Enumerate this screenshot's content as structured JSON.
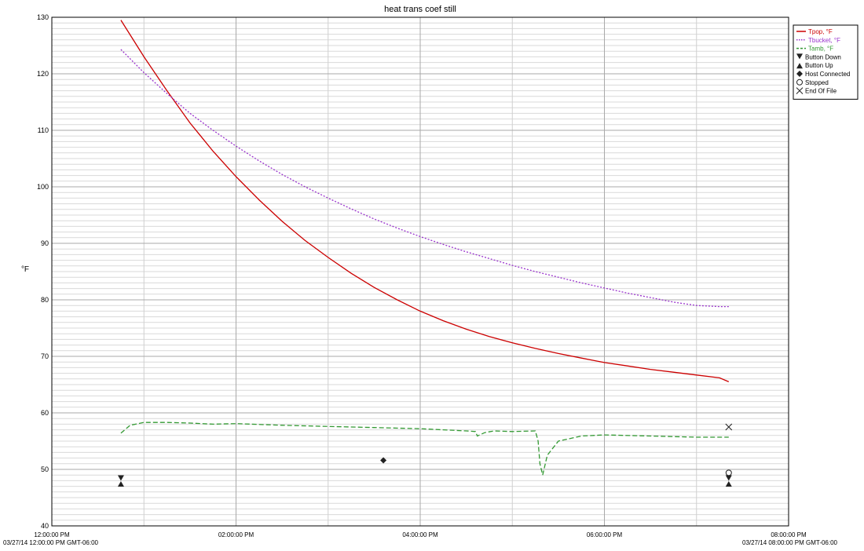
{
  "chart_data": {
    "type": "line",
    "title": "heat trans coef still",
    "ylabel": "°F",
    "ylim": [
      40,
      130
    ],
    "yticks": [
      40,
      50,
      60,
      70,
      80,
      90,
      100,
      110,
      120,
      130
    ],
    "xlim_hours": [
      0,
      8
    ],
    "xticks": [
      {
        "hour": 0,
        "label": "12:00:00 PM",
        "sublabel": "03/27/14 12:00:00 PM GMT-06:00"
      },
      {
        "hour": 2,
        "label": "02:00:00 PM",
        "sublabel": ""
      },
      {
        "hour": 4,
        "label": "04:00:00 PM",
        "sublabel": ""
      },
      {
        "hour": 6,
        "label": "06:00:00 PM",
        "sublabel": ""
      },
      {
        "hour": 8,
        "label": "08:00:00 PM",
        "sublabel": "03/27/14 08:00:00 PM GMT-06:00"
      }
    ],
    "x_unit": "hours after 12:00:00 PM",
    "grid": true,
    "legend_position": "top-right",
    "series": [
      {
        "name": "Tpop, °F",
        "color": "#cc0000",
        "style": "solid",
        "x": [
          0.75,
          1.0,
          1.25,
          1.5,
          1.75,
          2.0,
          2.25,
          2.5,
          2.75,
          3.0,
          3.25,
          3.5,
          3.75,
          4.0,
          4.25,
          4.5,
          4.75,
          5.0,
          5.25,
          5.5,
          5.75,
          6.0,
          6.25,
          6.5,
          6.75,
          7.0,
          7.25,
          7.35
        ],
        "y": [
          129.5,
          123.0,
          117.0,
          111.3,
          106.3,
          101.8,
          97.7,
          93.9,
          90.5,
          87.5,
          84.7,
          82.2,
          80.0,
          78.0,
          76.3,
          74.8,
          73.5,
          72.4,
          71.4,
          70.5,
          69.7,
          68.9,
          68.3,
          67.7,
          67.2,
          66.7,
          66.2,
          65.5
        ]
      },
      {
        "name": "Tbucket, °F",
        "color": "#9933cc",
        "style": "dotted",
        "x": [
          0.75,
          1.0,
          1.25,
          1.5,
          1.75,
          2.0,
          2.25,
          2.5,
          2.75,
          3.0,
          3.25,
          3.5,
          3.75,
          4.0,
          4.25,
          4.5,
          4.75,
          5.0,
          5.25,
          5.5,
          5.75,
          6.0,
          6.25,
          6.5,
          6.75,
          7.0,
          7.25,
          7.35
        ],
        "y": [
          124.3,
          120.2,
          116.5,
          113.0,
          110.0,
          107.2,
          104.6,
          102.2,
          100.0,
          98.0,
          96.1,
          94.3,
          92.7,
          91.2,
          89.8,
          88.5,
          87.3,
          86.1,
          85.0,
          84.0,
          83.0,
          82.1,
          81.2,
          80.4,
          79.6,
          79.0,
          78.8,
          78.8
        ]
      },
      {
        "name": "Tamb, °F",
        "color": "#339933",
        "style": "dashed",
        "x": [
          0.75,
          0.85,
          1.0,
          1.25,
          1.5,
          1.75,
          2.0,
          2.5,
          3.0,
          3.5,
          4.0,
          4.25,
          4.5,
          4.6,
          4.62,
          4.7,
          4.8,
          5.0,
          5.25,
          5.28,
          5.3,
          5.33,
          5.38,
          5.5,
          5.75,
          6.0,
          6.5,
          7.0,
          7.35
        ],
        "y": [
          56.4,
          57.8,
          58.3,
          58.3,
          58.2,
          58.0,
          58.1,
          57.8,
          57.6,
          57.4,
          57.2,
          57.0,
          56.8,
          56.7,
          55.9,
          56.5,
          56.8,
          56.7,
          56.8,
          55.0,
          51.0,
          49.0,
          52.5,
          55.0,
          55.9,
          56.1,
          55.9,
          55.7,
          55.7
        ]
      }
    ],
    "markers": [
      {
        "name": "Button Down",
        "symbol": "triangle-down",
        "points": [
          [
            0.75,
            48.4
          ],
          [
            7.35,
            48.4
          ]
        ]
      },
      {
        "name": "Button Up",
        "symbol": "triangle-up",
        "points": [
          [
            0.75,
            47.5
          ],
          [
            7.35,
            47.5
          ]
        ]
      },
      {
        "name": "Host Connected",
        "symbol": "diamond",
        "points": [
          [
            3.6,
            51.6
          ]
        ]
      },
      {
        "name": "Stopped",
        "symbol": "circle",
        "points": [
          [
            7.35,
            49.4
          ]
        ]
      },
      {
        "name": "End Of File",
        "symbol": "x",
        "points": [
          [
            7.35,
            57.5
          ]
        ]
      }
    ]
  }
}
